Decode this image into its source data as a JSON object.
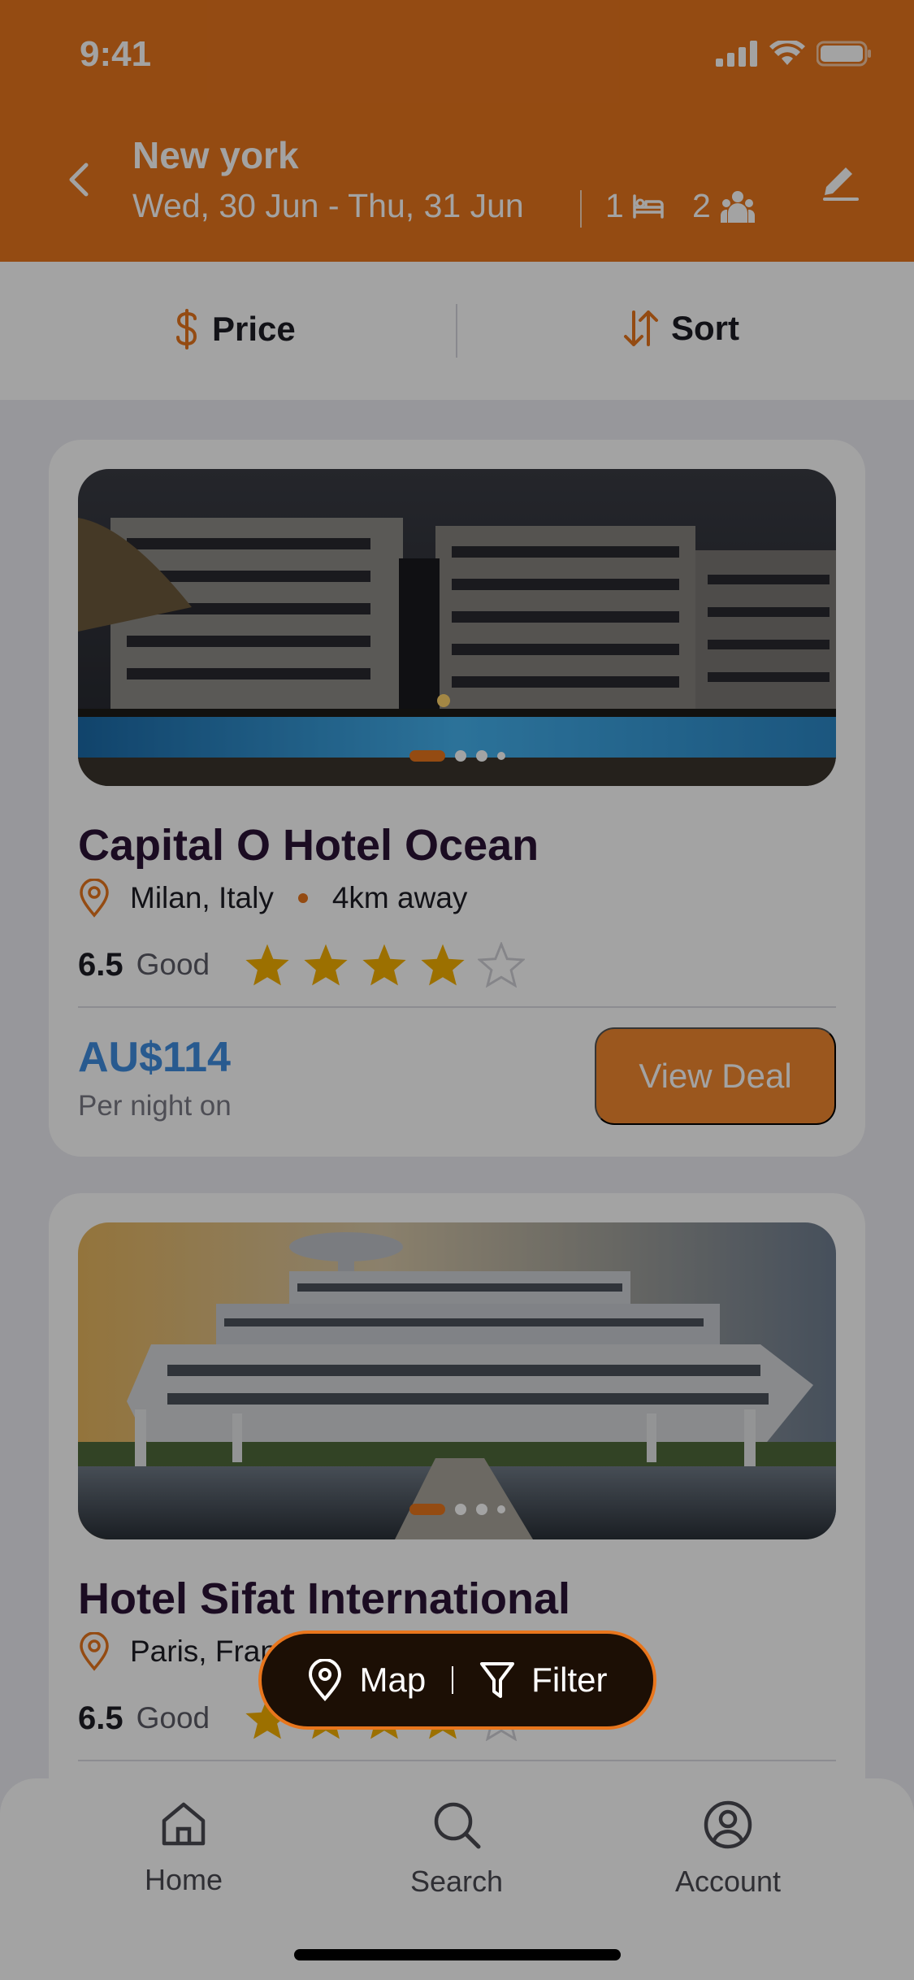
{
  "status_bar": {
    "time": "9:41"
  },
  "header": {
    "location": "New york",
    "dates": "Wed, 30 Jun -  Thu, 31 Jun",
    "rooms": "1",
    "guests": "2"
  },
  "sortbar": {
    "price_label": "Price",
    "sort_label": "Sort"
  },
  "hotels": [
    {
      "name": "Capital O Hotel Ocean",
      "location": "Milan, Italy",
      "distance": "4km away",
      "score": "6.5",
      "score_label": "Good",
      "stars": 4,
      "price": "AU$114",
      "price_note": "Per night on",
      "cta": "View Deal"
    },
    {
      "name": "Hotel Sifat International",
      "location": "Paris, France",
      "score": "6.5",
      "score_label": "Good",
      "stars": 4
    }
  ],
  "floating": {
    "map_label": "Map",
    "filter_label": "Filter"
  },
  "nav": {
    "home": "Home",
    "search": "Search",
    "account": "Account"
  },
  "colors": {
    "accent": "#e8761d",
    "price": "#3f8de0",
    "title": "#2b1336",
    "star": "#f5b000"
  }
}
